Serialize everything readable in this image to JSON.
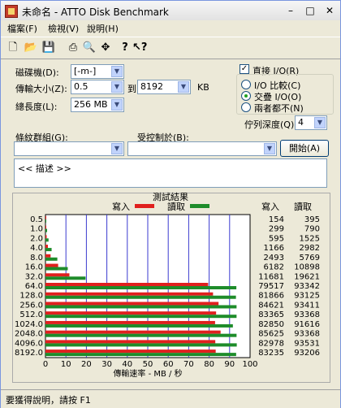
{
  "window": {
    "title": "未命名 - ATTO Disk Benchmark",
    "minimize": "–",
    "maximize": "□",
    "close": "✕"
  },
  "menu": {
    "file": "檔案(F)",
    "view": "檢視(V)",
    "help": "說明(H)"
  },
  "toolbar": {
    "icons": [
      "new-icon",
      "open-icon",
      "save-icon",
      "print-icon",
      "print-preview-icon",
      "move-icon",
      "about-icon",
      "help-icon",
      "context-help-icon"
    ]
  },
  "settings": {
    "drive_label": "磁碟機(D):",
    "drive_value": "[-m-]",
    "transfer_label": "傳輸大小(Z):",
    "transfer_from": "0.5",
    "to_label": "到",
    "transfer_to": "8192",
    "kb_label": "KB",
    "length_label": "總長度(L):",
    "length_value": "256 MB",
    "direct_io_label": "直接 I/O(R)",
    "direct_io_checked": true,
    "io_compare_label": "I/O 比較(C)",
    "overlapped_io_label": "交疊 I/O(O)",
    "neither_label": "兩者都不(N)",
    "queue_depth_label": "佇列深度(Q):",
    "queue_depth_value": "4",
    "bench_group_label": "條紋群組(G):",
    "controlled_by_label": "受控制於(B):",
    "start_button": "開始(A)",
    "description_text": "<< 描述 >>"
  },
  "results": {
    "title": "測試結果",
    "write_legend": "寫入",
    "read_legend": "讀取",
    "write_col": "寫入",
    "read_col": "讀取",
    "write_color": "#e0201e",
    "read_color": "#1e8c2a"
  },
  "chart_data": {
    "type": "bar",
    "title": "測試結果",
    "xlabel": "傳輸速率 - MB / 秒",
    "xlim": [
      0,
      100
    ],
    "xticks": [
      "0",
      "10",
      "20",
      "30",
      "40",
      "50",
      "60",
      "70",
      "80",
      "90",
      "100"
    ],
    "categories": [
      "0.5",
      "1.0",
      "2.0",
      "4.0",
      "8.0",
      "16.0",
      "32.0",
      "64.0",
      "128.0",
      "256.0",
      "512.0",
      "1024.0",
      "2048.0",
      "4096.0",
      "8192.0"
    ],
    "series": [
      {
        "name": "寫入",
        "values": [
          0.15,
          0.3,
          0.6,
          1.2,
          2.5,
          6.2,
          11.7,
          79.5,
          81.9,
          84.6,
          83.4,
          82.9,
          85.6,
          83.0,
          83.2
        ],
        "raw": [
          "154",
          "299",
          "595",
          "1166",
          "2493",
          "6182",
          "11681",
          "79517",
          "81866",
          "84621",
          "83365",
          "82850",
          "85625",
          "82978",
          "83235"
        ]
      },
      {
        "name": "讀取",
        "values": [
          0.4,
          0.8,
          1.5,
          3.0,
          5.8,
          10.9,
          19.6,
          93.3,
          93.1,
          93.4,
          93.4,
          91.6,
          93.4,
          93.5,
          93.2
        ],
        "raw": [
          "395",
          "790",
          "1525",
          "2982",
          "5769",
          "10898",
          "19621",
          "93342",
          "93125",
          "93411",
          "93368",
          "91616",
          "93368",
          "93531",
          "93206"
        ]
      }
    ]
  },
  "status": {
    "text": "要獲得說明，請按 F1"
  }
}
